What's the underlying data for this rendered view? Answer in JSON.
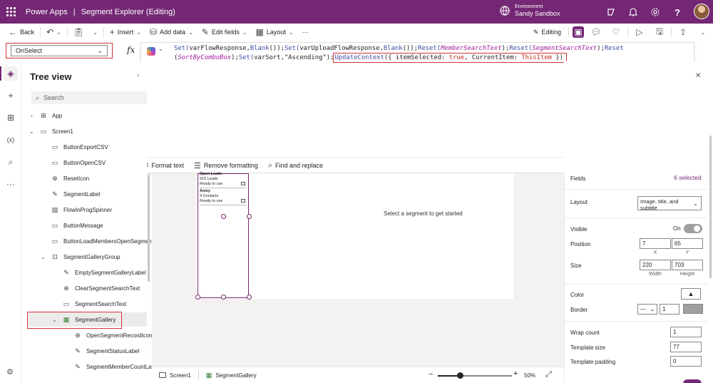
{
  "header": {
    "app_name": "Power Apps",
    "separator": "|",
    "document_title": "Segment Explorer (Editing)",
    "environment_label": "Environment",
    "environment_name": "Sandy Sandbox"
  },
  "commandbar": {
    "back": "Back",
    "insert": "Insert",
    "add_data": "Add data",
    "edit_fields": "Edit fields",
    "layout": "Layout",
    "more": "···",
    "editing": "Editing"
  },
  "formula": {
    "property": "OnSelect",
    "fx": "fx",
    "line1_parts": [
      {
        "t": "Set(",
        "c": "fn"
      },
      {
        "t": "varFlowResponse",
        "c": "str"
      },
      {
        "t": ",",
        "c": "str"
      },
      {
        "t": "Blank",
        "c": "fn"
      },
      {
        "t": "());",
        "c": "str"
      },
      {
        "t": "Set(",
        "c": "fn"
      },
      {
        "t": "varUploadFlowResponse",
        "c": "str"
      },
      {
        "t": ",",
        "c": "str"
      },
      {
        "t": "Blank",
        "c": "fn"
      },
      {
        "t": "());",
        "c": "str"
      },
      {
        "t": "Reset(",
        "c": "fn"
      },
      {
        "t": "MemberSearchText",
        "c": "param"
      },
      {
        "t": ");",
        "c": "str"
      },
      {
        "t": "Reset(",
        "c": "fn"
      },
      {
        "t": "SegmentSearchText",
        "c": "param"
      },
      {
        "t": ");",
        "c": "str"
      },
      {
        "t": "Reset",
        "c": "fn"
      }
    ],
    "line2_parts": [
      {
        "t": "(",
        "c": "str"
      },
      {
        "t": "SortByComboBox",
        "c": "param"
      },
      {
        "t": ");",
        "c": "str"
      },
      {
        "t": "Set(",
        "c": "fn"
      },
      {
        "t": "varSort",
        "c": "str"
      },
      {
        "t": ",\"Ascending\");",
        "c": "str"
      }
    ],
    "highlighted_parts": [
      {
        "t": "UpdateContext",
        "c": "fn"
      },
      {
        "t": "({ itemSelected: ",
        "c": "str"
      },
      {
        "t": "true",
        "c": "kw"
      },
      {
        "t": ", CurrentItem: ",
        "c": "str"
      },
      {
        "t": "ThisItem",
        "c": "kw"
      },
      {
        "t": " })",
        "c": "str"
      }
    ],
    "format_text": "Format text",
    "remove_formatting": "Remove formatting",
    "find_replace": "Find and replace"
  },
  "tree": {
    "title": "Tree view",
    "search_placeholder": "Search",
    "items": [
      {
        "label": "App",
        "kind": "app"
      },
      {
        "label": "Screen1",
        "kind": "screen"
      },
      {
        "label": "ButtonExportCSV",
        "kind": "button"
      },
      {
        "label": "ButtonOpenCSV",
        "kind": "button"
      },
      {
        "label": "ResetIcon",
        "kind": "icon"
      },
      {
        "label": "SegmentLabel",
        "kind": "label"
      },
      {
        "label": "FlowInProgSpinner",
        "kind": "image"
      },
      {
        "label": "ButtonMessage",
        "kind": "button"
      },
      {
        "label": "ButtonLoadMembersOpenSegment",
        "kind": "button"
      },
      {
        "label": "SegmentGalleryGroup",
        "kind": "group"
      },
      {
        "label": "EmptySegmentGalleryLabel",
        "kind": "label"
      },
      {
        "label": "ClearSegmentSearchText",
        "kind": "icon"
      },
      {
        "label": "SegmentSearchText",
        "kind": "input"
      },
      {
        "label": "SegmentGallery",
        "kind": "gallery"
      },
      {
        "label": "OpenSegmentRecordIcon",
        "kind": "icon"
      },
      {
        "label": "SegmentStatusLabel",
        "kind": "label"
      },
      {
        "label": "SegmentMemberCountLabel",
        "kind": "label"
      }
    ]
  },
  "canvas": {
    "gallery_items": [
      {
        "name": "Open Leads",
        "count": "915 Leads",
        "status": "Ready to use"
      },
      {
        "name": "Amey",
        "count": "4 Contacts",
        "status": "Ready to use"
      }
    ],
    "empty_message": "Select a segment to get started"
  },
  "statusbar": {
    "screen": "Screen1",
    "control": "SegmentGallery",
    "zoom": "50%",
    "zoom_fraction": 0.5
  },
  "properties": {
    "fields_label": "Fields",
    "fields_value": "6 selected",
    "layout_label": "Layout",
    "layout_value": "Image, title, and subtitle",
    "visible_label": "Visible",
    "visible_value": "On",
    "position_label": "Position",
    "position_x": "7",
    "position_y": "65",
    "x_label": "X",
    "y_label": "Y",
    "size_label": "Size",
    "width": "220",
    "height": "703",
    "width_label": "Width",
    "height_label": "Height",
    "color_label": "Color",
    "border_label": "Border",
    "border_width": "1",
    "wrap_label": "Wrap count",
    "wrap_value": "1",
    "template_size_label": "Template size",
    "template_size_value": "77",
    "template_padding_label": "Template padding",
    "template_padding_value": "0"
  },
  "colors": {
    "brand": "#742774",
    "highlight": "#d13438"
  }
}
